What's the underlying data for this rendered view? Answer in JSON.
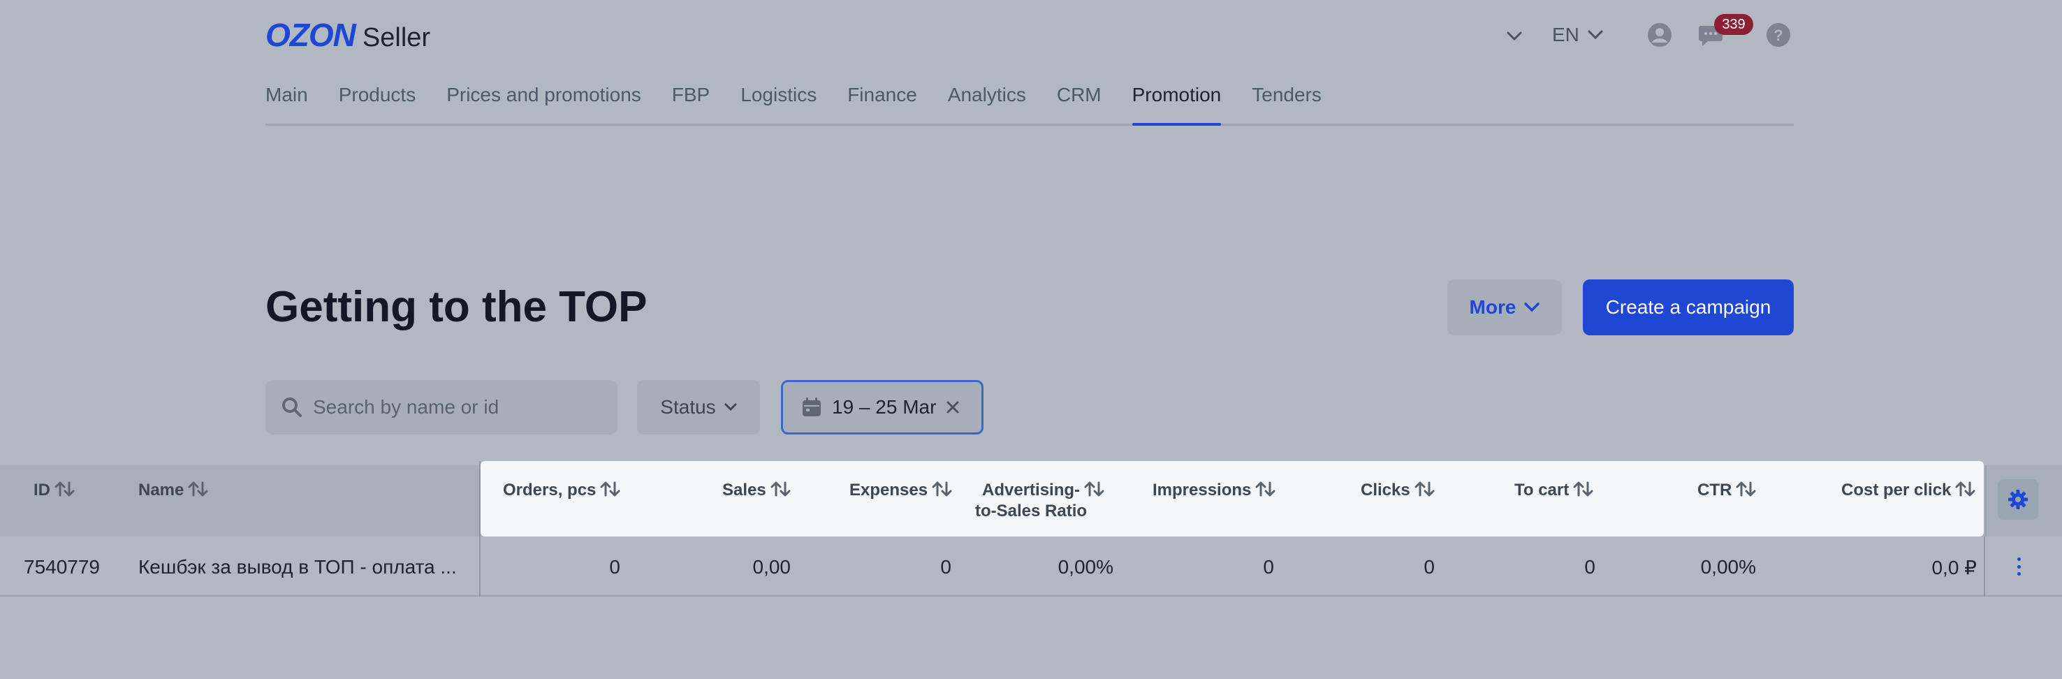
{
  "header": {
    "logo_brand": "OZON",
    "logo_suffix": "Seller",
    "language": "EN",
    "chat_badge": "339"
  },
  "nav": {
    "items": [
      {
        "label": "Main"
      },
      {
        "label": "Products"
      },
      {
        "label": "Prices and promotions"
      },
      {
        "label": "FBP"
      },
      {
        "label": "Logistics"
      },
      {
        "label": "Finance"
      },
      {
        "label": "Analytics"
      },
      {
        "label": "CRM"
      },
      {
        "label": "Promotion"
      },
      {
        "label": "Tenders"
      }
    ],
    "active": "Promotion"
  },
  "page": {
    "title": "Getting to the TOP",
    "more_label": "More",
    "create_label": "Create a campaign"
  },
  "filters": {
    "search_placeholder": "Search by name or id",
    "status_label": "Status",
    "date_range": "19 – 25 Mar"
  },
  "table": {
    "columns": {
      "id": "ID",
      "name": "Name",
      "orders": "Orders, pcs",
      "sales": "Sales",
      "expenses": "Expenses",
      "ratio_line1": "Advertising-",
      "ratio_line2": "to-Sales Ratio",
      "impressions": "Impressions",
      "clicks": "Clicks",
      "to_cart": "To cart",
      "ctr": "CTR",
      "cpc": "Cost per click"
    },
    "rows": [
      {
        "id": "7540779",
        "name": "Кешбэк за вывод в ТОП - оплата ...",
        "orders": "0",
        "sales": "0,00",
        "expenses": "0",
        "ratio": "0,00%",
        "impressions": "0",
        "clicks": "0",
        "to_cart": "0",
        "ctr": "0,00%",
        "cpc": "0,0 ₽"
      }
    ]
  },
  "colors": {
    "accent": "#1f47d4",
    "background": "#b0b8c1",
    "badge": "#8c1f35"
  }
}
